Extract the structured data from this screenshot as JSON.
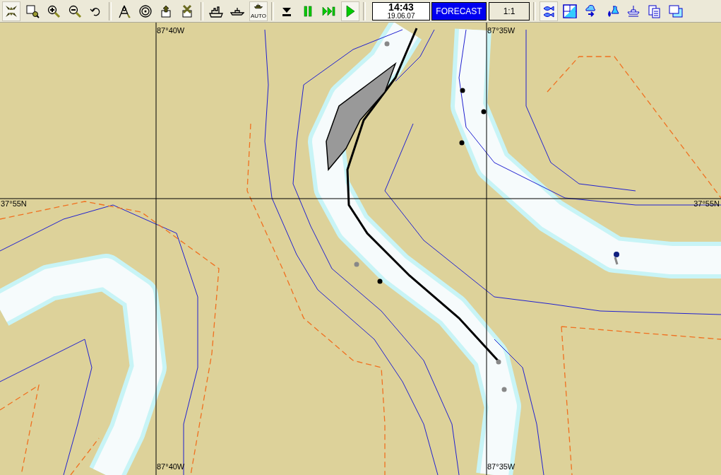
{
  "toolbar": {
    "groups": [
      {
        "buttons": [
          {
            "pressed": true
          },
          {
            "pressed": false
          },
          {
            "pressed": false
          },
          {
            "pressed": false
          },
          {
            "pressed": false
          }
        ]
      },
      {
        "buttons": [
          {
            "pressed": false
          },
          {
            "pressed": false
          },
          {
            "pressed": false
          },
          {
            "pressed": false
          }
        ]
      },
      {
        "buttons": [
          {
            "pressed": false
          },
          {
            "pressed": false
          },
          {
            "pressed": true,
            "label": "AUTO"
          }
        ]
      },
      {
        "buttons": [
          {
            "pressed": false
          },
          {
            "pressed": false
          },
          {
            "pressed": false
          },
          {
            "pressed": true
          }
        ]
      }
    ],
    "clock": {
      "time": "14:43",
      "date": "19.06.07"
    },
    "forecast": {
      "label": "FORECAST",
      "selected": true
    },
    "scale": {
      "label": "1:1"
    },
    "tools": [
      {
        "pressed": true
      },
      {
        "pressed": false
      },
      {
        "pressed": false
      },
      {
        "pressed": false
      },
      {
        "pressed": false
      },
      {
        "pressed": false
      },
      {
        "pressed": false
      }
    ]
  },
  "chart": {
    "meridians": [
      {
        "label_top": "87°40W",
        "label_bottom": "87°40W"
      },
      {
        "label_top": "87°35W",
        "label_bottom": "87°35W"
      }
    ],
    "parallels": [
      {
        "label_left": "37°55N",
        "label_right": "37°55N"
      }
    ]
  }
}
